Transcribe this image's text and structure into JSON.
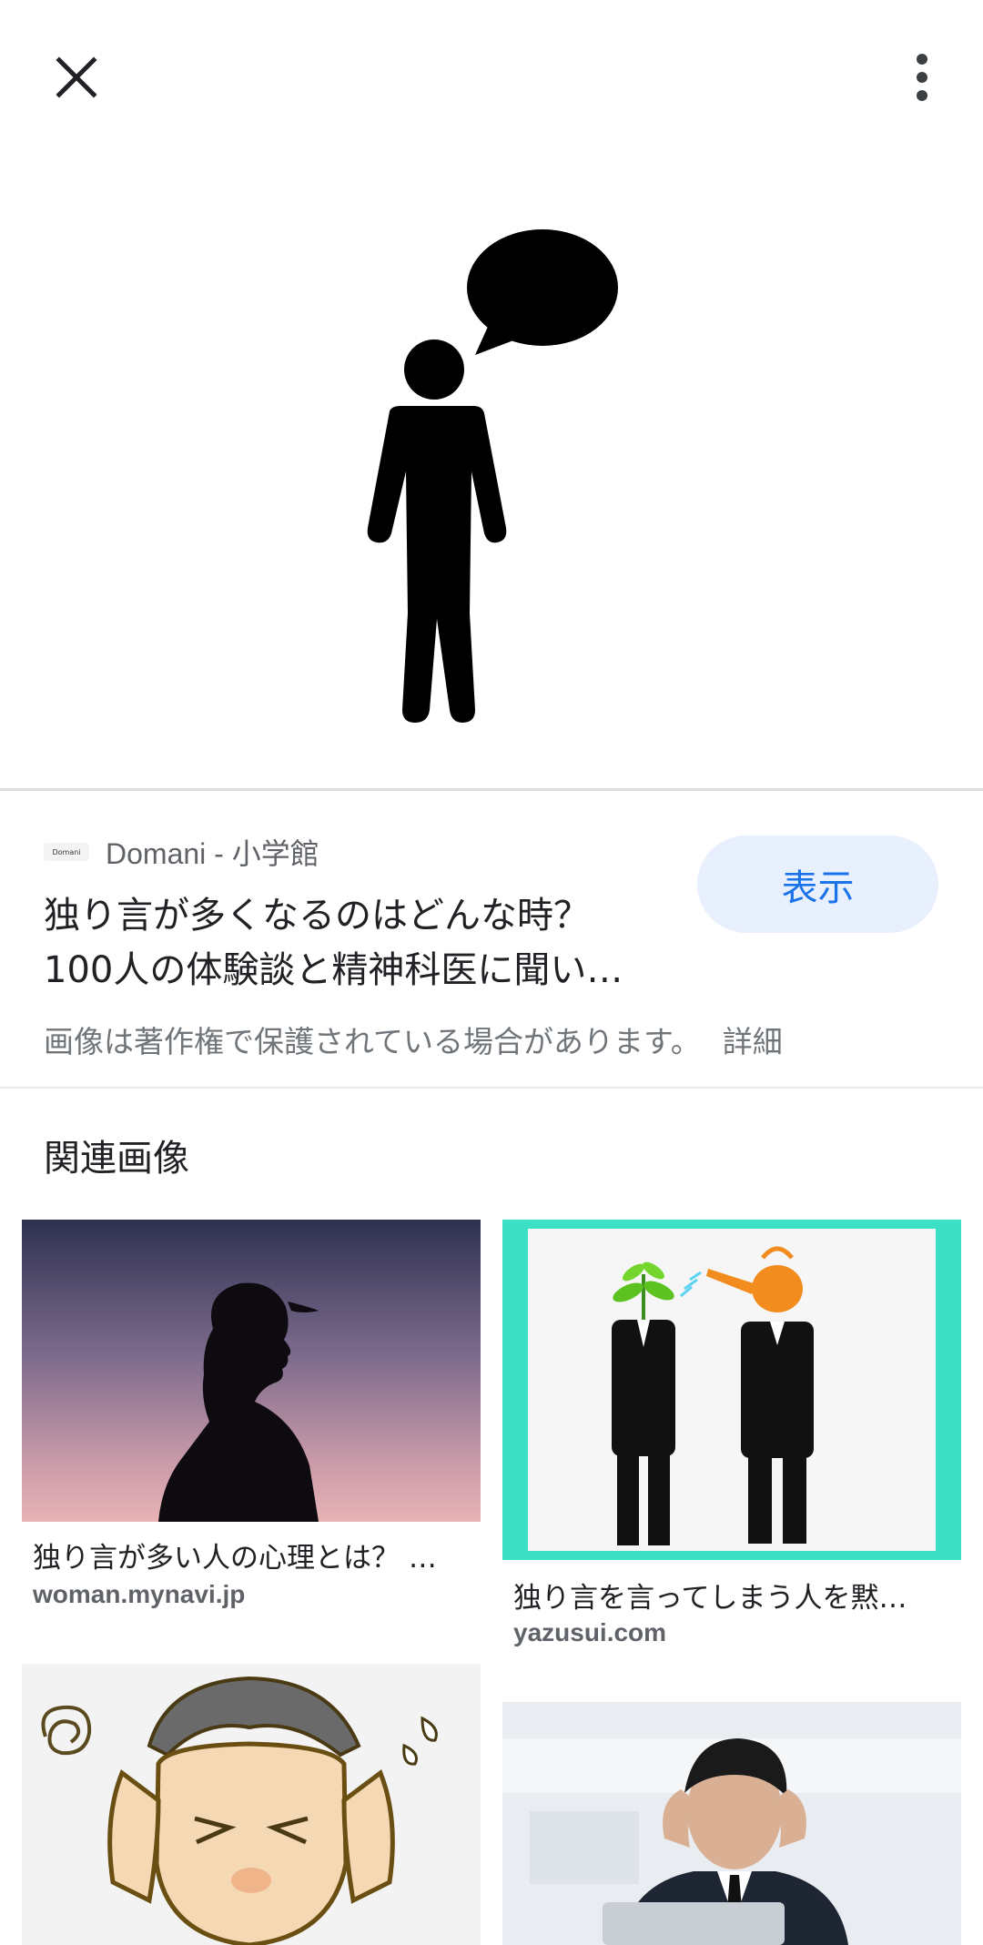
{
  "toolbar": {
    "close_icon": "close-icon",
    "more_icon": "more-vert-icon"
  },
  "hero": {
    "image": "person-speech-bubble-pictogram"
  },
  "result": {
    "favicon_text": "Domani",
    "source": "Domani - 小学館",
    "title_line1": "独り言が多くなるのはどんな時？",
    "title_line2": "100人の体験談と精神科医に聞い…",
    "visit_label": "表示",
    "copyright_notice": "画像は著作権で保護されている場合があります。",
    "details_link": "詳細"
  },
  "related": {
    "heading": "関連画像",
    "items": [
      {
        "title": "独り言が多い人の心理とは？ …",
        "domain": "woman.mynavi.jp"
      },
      {
        "title": "独り言を言ってしまう人を黙…",
        "domain": "yazusui.com"
      },
      {
        "title": "",
        "domain": ""
      },
      {
        "title": "",
        "domain": ""
      }
    ]
  },
  "colors": {
    "accent": "#1a73e8",
    "button_bg": "#e8f0fe",
    "secondary_text": "#5f6368"
  }
}
